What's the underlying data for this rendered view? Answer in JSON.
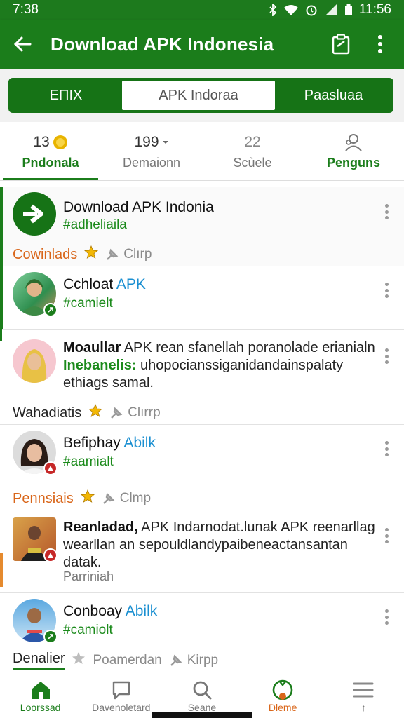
{
  "status_bar": {
    "time_left": "7:38",
    "time_right": "11:56"
  },
  "app_bar": {
    "title": "Download APK Indonesia"
  },
  "segments": [
    {
      "label": "ΕΠΙΧ"
    },
    {
      "label": "APK Indoraa"
    },
    {
      "label": "Paasluaa"
    }
  ],
  "stats": [
    {
      "value": "13",
      "label": "Pndonala"
    },
    {
      "value": "199",
      "label": "Demaionn"
    },
    {
      "value": "22",
      "label": "Scùele"
    },
    {
      "value": "",
      "label": "Penguns"
    }
  ],
  "feed": [
    {
      "name": "Download APK Indonia",
      "tag": "#adheliaila",
      "category": "Cowinlads",
      "action": "Clırp"
    },
    {
      "name": "Cchloat ",
      "name_highlight": "APK",
      "tag": "#camielt"
    },
    {
      "text_bold": "Moaullar",
      "text": " APK rean sfanellah poranolade erianialn ",
      "text_green": "Inebanelis:",
      "text_rest": " uhopocianssiganidandainspalaty ethiags samal.",
      "category": "Wahadiatis",
      "action": "Clırrp"
    },
    {
      "name": "Befiphay ",
      "name_highlight": "Abilk",
      "tag": "#aamialt",
      "category": "Pennsiais",
      "action": "Clmp"
    },
    {
      "text_bold": "Reanladad,",
      "text": " APK Indarnodat.lunak APK reenarllag wearllan an sepouldlandypaibeneactansantan datak.",
      "subtext": "Parriniah"
    },
    {
      "name": "Conboay ",
      "name_highlight": "Abilk",
      "tag": "#camiolt",
      "category": "Denalier",
      "action": "Poamerdan",
      "action2": "Kirpp"
    }
  ],
  "bottom_nav": [
    {
      "label": "Loorssad"
    },
    {
      "label": "Davenoletard"
    },
    {
      "label": "Seane"
    },
    {
      "label": "Dleme"
    },
    {
      "label": "↑"
    }
  ],
  "colors": {
    "primary": "#1b7d1b",
    "accent_orange": "#d9661a",
    "link_blue": "#1a8fd1",
    "star": "#f2b705"
  }
}
